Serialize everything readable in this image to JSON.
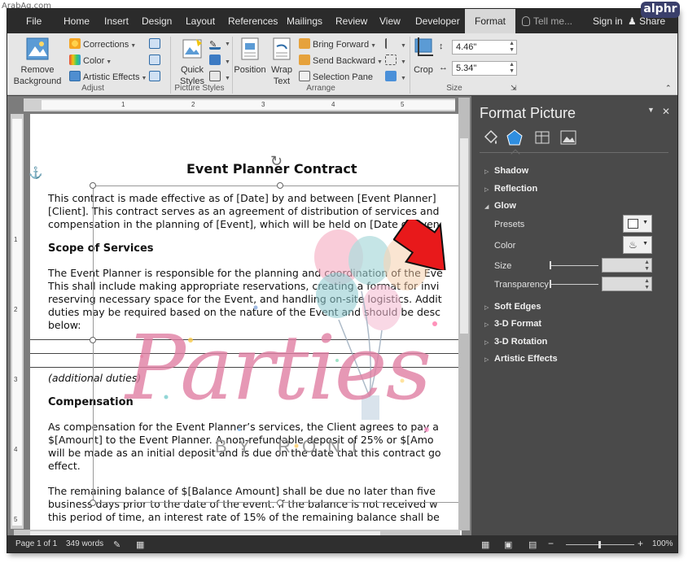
{
  "watermark": "ArabAq.com",
  "brand_badge": "alphr",
  "ribbon_tabs": [
    "File",
    "Home",
    "Insert",
    "Design",
    "Layout",
    "References",
    "Mailings",
    "Review",
    "View",
    "Developer",
    "Format"
  ],
  "active_tab": "Format",
  "tell_me": "Tell me...",
  "sign_in": "Sign in",
  "share": "Share",
  "ribbon": {
    "remove_background": "Remove Background",
    "corrections": "Corrections",
    "color": "Color",
    "artistic_effects": "Artistic Effects",
    "adjust_label": "Adjust",
    "quick_styles": "Quick Styles",
    "picture_styles_label": "Picture Styles",
    "position": "Position",
    "wrap_text": "Wrap Text",
    "bring_forward": "Bring Forward",
    "send_backward": "Send Backward",
    "selection_pane": "Selection Pane",
    "arrange_label": "Arrange",
    "crop": "Crop",
    "height_value": "4.46\"",
    "width_value": "5.34\"",
    "size_label": "Size"
  },
  "ruler_numbers": [
    "1",
    "2",
    "3",
    "4",
    "5"
  ],
  "vruler_numbers": [
    "1",
    "2",
    "3",
    "4",
    "5"
  ],
  "document": {
    "title": "Event Planner Contract",
    "p1": [
      "This contract is made effective as of [Date] by and between [Event Planner]",
      "[Client]. This contract serves as an agreement of distribution of services and",
      "compensation in the planning of [Event], which will be held on [Date of Even"
    ],
    "scope_heading": "Scope of Services",
    "p2": [
      "The Event Planner is responsible for the planning and coordination of the Eve",
      "This shall include making appropriate reservations, creating a format for invi",
      "reserving necessary space for the Event, and handling on-site logistics. Addit",
      "duties may be required based on the nature of the Event and should be desc",
      "below:"
    ],
    "additional_duties": "(additional duties)",
    "comp_heading": "Compensation",
    "p3": [
      "As compensation for the Event Planner’s services, the Client agrees to pay a",
      "$[Amount] to the Event Planner. A non-refundable deposit of 25% or $[Amo",
      "will be made as an initial deposit and is due on the date that this contract go",
      "effect."
    ],
    "p4": [
      "The remaining balance of $[Balance Amount] shall be due no later than five",
      "business days prior to the date of the event. If the balance is not received w",
      "this period of time, an interest rate of 15% of the remaining balance shall be"
    ],
    "logo_main": "Parties",
    "logo_sub": "BY RONI"
  },
  "format_pane": {
    "title": "Format Picture",
    "sections": {
      "shadow": "Shadow",
      "reflection": "Reflection",
      "glow": "Glow",
      "soft_edges": "Soft Edges",
      "format_3d": "3-D Format",
      "rotation_3d": "3-D Rotation",
      "artistic_effects": "Artistic Effects"
    },
    "glow_options": {
      "presets": "Presets",
      "color": "Color",
      "size": "Size",
      "transparency": "Transparency"
    }
  },
  "status_bar": {
    "page": "Page 1 of 1",
    "words": "349 words",
    "zoom": "100%"
  }
}
